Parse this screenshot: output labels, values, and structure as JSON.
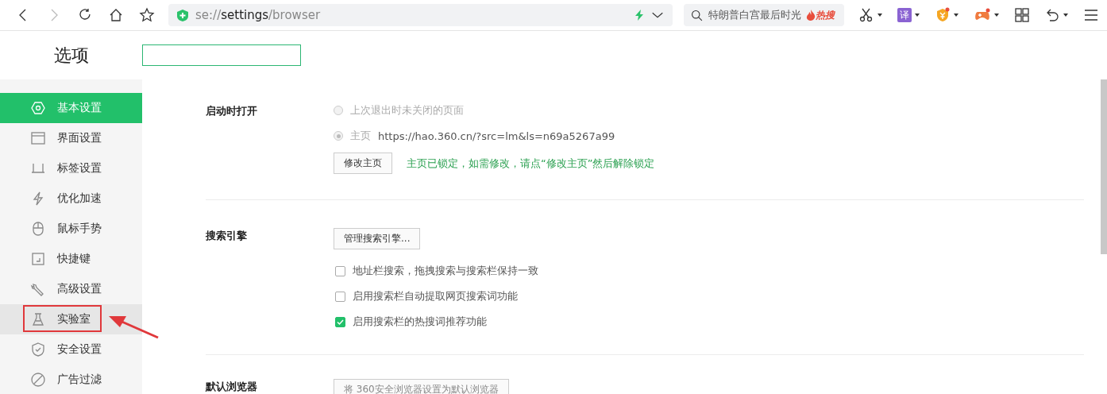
{
  "toolbar": {
    "address": {
      "scheme": "se://",
      "host": "settings",
      "path": "/browser"
    },
    "search": {
      "placeholder": "特朗普白宫最后时光",
      "hot_badge": "热搜"
    },
    "translate_label": "译"
  },
  "header": {
    "title": "选项"
  },
  "sidebar": {
    "items": [
      {
        "label": "基本设置",
        "selected": true,
        "highlighted": false,
        "annotated": false
      },
      {
        "label": "界面设置",
        "selected": false,
        "highlighted": false,
        "annotated": false
      },
      {
        "label": "标签设置",
        "selected": false,
        "highlighted": false,
        "annotated": false
      },
      {
        "label": "优化加速",
        "selected": false,
        "highlighted": false,
        "annotated": false
      },
      {
        "label": "鼠标手势",
        "selected": false,
        "highlighted": false,
        "annotated": false
      },
      {
        "label": "快捷键",
        "selected": false,
        "highlighted": false,
        "annotated": false
      },
      {
        "label": "高级设置",
        "selected": false,
        "highlighted": false,
        "annotated": false
      },
      {
        "label": "实验室",
        "selected": false,
        "highlighted": true,
        "annotated": true
      },
      {
        "label": "安全设置",
        "selected": false,
        "highlighted": false,
        "annotated": false
      },
      {
        "label": "广告过滤",
        "selected": false,
        "highlighted": false,
        "annotated": false
      }
    ]
  },
  "sections": [
    {
      "title": "启动时打开",
      "kind": "startup",
      "options": [
        {
          "label": "上次退出时未关闭的页面",
          "selected": false,
          "disabled": true
        },
        {
          "label": "主页",
          "url": "https://hao.360.cn/?src=lm&ls=n69a5267a99",
          "selected": true,
          "disabled": true
        }
      ],
      "button": "修改主页",
      "note": "主页已锁定，如需修改，请点“修改主页”然后解除锁定"
    },
    {
      "title": "搜索引擎",
      "kind": "search",
      "button": "管理搜索引擎...",
      "checkboxes": [
        {
          "label": "地址栏搜索，拖拽搜索与搜索栏保持一致",
          "checked": false
        },
        {
          "label": "启用搜索栏自动提取网页搜索词功能",
          "checked": false
        },
        {
          "label": "启用搜索栏的热搜词推荐功能",
          "checked": true
        }
      ]
    },
    {
      "title": "默认浏览器",
      "kind": "default",
      "button": "将 360安全浏览器设置为默认浏览器",
      "disabled": true
    }
  ]
}
